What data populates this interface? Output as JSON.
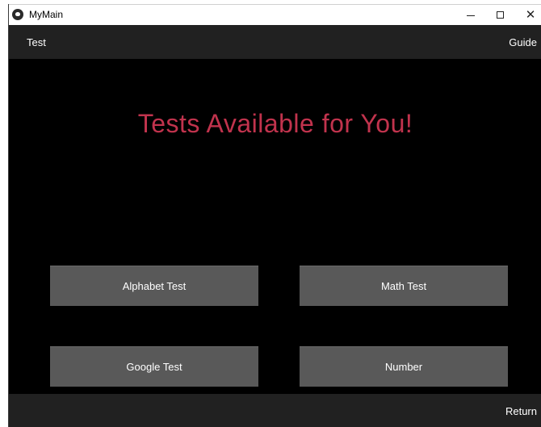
{
  "window": {
    "title": "MyMain",
    "minimize_glyph": "minimize-icon",
    "maximize_glyph": "maximize-icon",
    "close_label": "✕"
  },
  "topbar": {
    "left_action": "Test",
    "right_action": "Guide"
  },
  "main": {
    "heading": "Tests Available for You!",
    "buttons": [
      {
        "label": "Alphabet Test"
      },
      {
        "label": "Math Test"
      },
      {
        "label": "Google Test"
      },
      {
        "label": "Number"
      }
    ]
  },
  "bottombar": {
    "right_action": "Return"
  },
  "colors": {
    "background": "#000000",
    "bar": "#212121",
    "button": "#595959",
    "heading": "#c1334d",
    "text": "#ffffff"
  }
}
